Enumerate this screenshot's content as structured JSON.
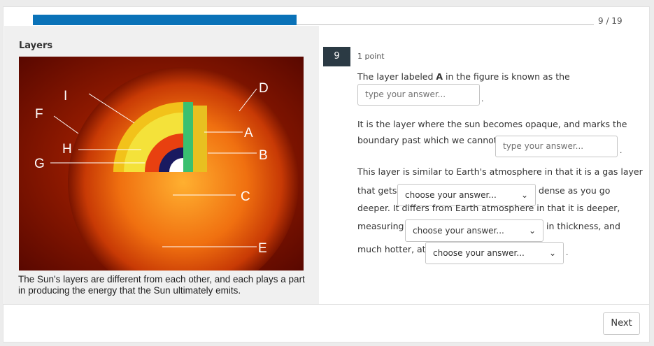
{
  "progress": {
    "value": 0.47,
    "label": "9 / 19"
  },
  "left": {
    "title": "Layers",
    "figure_labels": [
      "I",
      "D",
      "F",
      "A",
      "H",
      "B",
      "G",
      "C",
      "E"
    ],
    "caption": "The Sun's layers are different from each other, and each plays a part in producing the energy that the Sun ultimately emits."
  },
  "question": {
    "number": "9",
    "points": "1 point",
    "line1_pre": "The layer labeled ",
    "line1_bold": "A",
    "line1_post": " in the figure is known as the",
    "input1_placeholder": "type your answer...",
    "period1": ".",
    "line2": "It is the layer where the sun becomes opaque, and marks the",
    "line3": "boundary past which we cannot",
    "input2_placeholder": "type your answer...",
    "period2": ".",
    "line4": "This layer is similar to Earth's atmosphere in that it is a gas layer",
    "line5_pre": "that gets",
    "dropdown1": "choose your answer...",
    "line5_post": "dense as you go",
    "line6": "deeper. It differs from Earth atmosphere in that it is deeper,",
    "line7_pre": "measuring",
    "dropdown2": "choose your answer...",
    "line7_post": "in thickness, and",
    "line8_pre": "much hotter, at",
    "dropdown3": "choose your answer...",
    "period3": "."
  },
  "footer": {
    "next_label": "Next"
  },
  "colors": {
    "progress": "#0a72b8",
    "badge": "#2b3a44"
  }
}
